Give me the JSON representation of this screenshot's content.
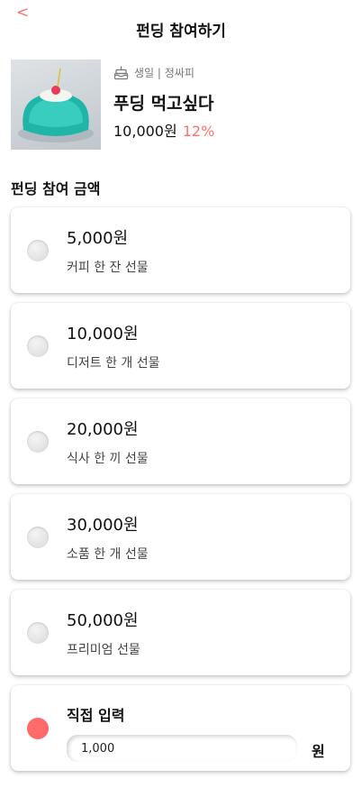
{
  "header": {
    "back_glyph": "<",
    "title": "펀딩 참여하기"
  },
  "product": {
    "category_icon": "cake-icon",
    "category": "생일 | 정싸피",
    "name": "푸딩 먹고싶다",
    "price": "10,000원",
    "percent": "12%"
  },
  "section_title": "펀딩 참여 금액",
  "options": [
    {
      "amount": "5,000원",
      "desc": "커피 한 잔 선물",
      "selected": false
    },
    {
      "amount": "10,000원",
      "desc": "디저트 한 개 선물",
      "selected": false
    },
    {
      "amount": "20,000원",
      "desc": "식사 한 끼 선물",
      "selected": false
    },
    {
      "amount": "30,000원",
      "desc": "소품 한 개 선물",
      "selected": false
    },
    {
      "amount": "50,000원",
      "desc": "프리미엄 선물",
      "selected": false
    }
  ],
  "custom": {
    "label": "직접 입력",
    "value": "1,000",
    "unit": "원",
    "selected": true
  },
  "colors": {
    "accent": "#ff6f6f"
  }
}
